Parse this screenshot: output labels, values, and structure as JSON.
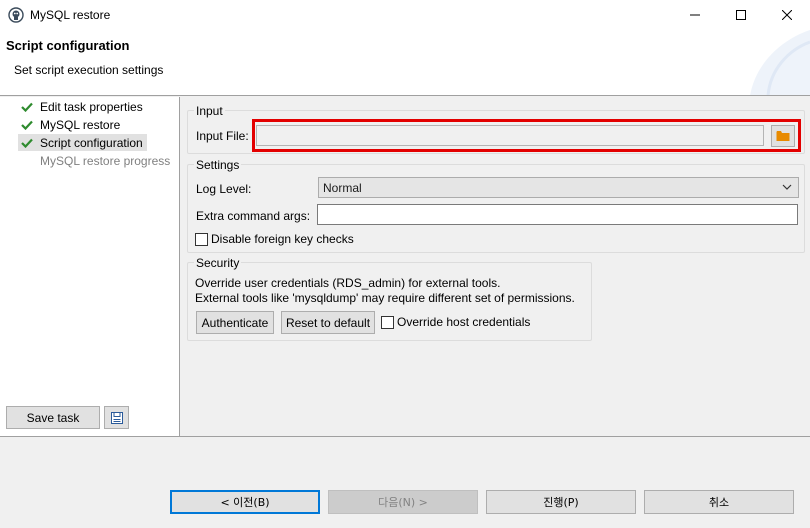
{
  "window": {
    "title": "MySQL restore"
  },
  "header": {
    "title": "Script configuration",
    "subtitle": "Set script execution settings"
  },
  "nav": {
    "items": [
      {
        "label": "Edit task properties",
        "done": true
      },
      {
        "label": "MySQL restore",
        "done": true
      },
      {
        "label": "Script configuration",
        "done": true
      },
      {
        "label": "MySQL restore progress",
        "done": false
      }
    ],
    "save_task_label": "Save task"
  },
  "input": {
    "group_label": "Input",
    "file_label": "Input File:",
    "file_value": ""
  },
  "settings": {
    "group_label": "Settings",
    "log_level_label": "Log Level:",
    "log_level_value": "Normal",
    "extra_args_label": "Extra command args:",
    "extra_args_value": "",
    "disable_fk_label": "Disable foreign key checks"
  },
  "security": {
    "group_label": "Security",
    "line1": "Override user credentials (RDS_admin) for external tools.",
    "line2": "External tools like 'mysqldump' may require different set of permissions.",
    "authenticate_label": "Authenticate",
    "reset_label": "Reset to default",
    "override_host_label": "Override host credentials"
  },
  "footer": {
    "back_label": "< 이전(B)",
    "next_label": "다음(N) >",
    "proceed_label": "진행(P)",
    "cancel_label": "취소"
  },
  "colors": {
    "highlight": "#e30000",
    "check": "#2e8b2e",
    "folder": "#e88a00",
    "default_button_border": "#0078d7"
  }
}
